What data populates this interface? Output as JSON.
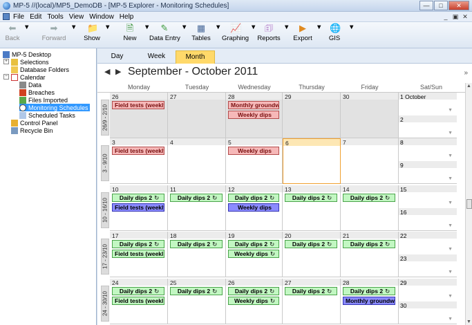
{
  "window": {
    "title": "MP-5 //(local)/MP5_DemoDB - [MP-5 Explorer - Monitoring Schedules]"
  },
  "menu": {
    "items": [
      "File",
      "Edit",
      "Tools",
      "View",
      "Window",
      "Help"
    ]
  },
  "toolbar": {
    "back": "Back",
    "forward": "Forward",
    "show": "Show",
    "new": "New",
    "data_entry": "Data Entry",
    "tables": "Tables",
    "graphing": "Graphing",
    "reports": "Reports",
    "export": "Export",
    "gis": "GIS"
  },
  "tree": {
    "root": "MP-5 Desktop",
    "selections": "Selections",
    "database_folders": "Database Folders",
    "calendar": "Calendar",
    "data": "Data",
    "breaches": "Breaches",
    "files_imported": "Files Imported",
    "monitoring_schedules": "Monitoring Schedules",
    "scheduled_tasks": "Scheduled Tasks",
    "control_panel": "Control Panel",
    "recycle_bin": "Recycle Bin"
  },
  "tabs": {
    "day": "Day",
    "week": "Week",
    "month": "Month"
  },
  "calendar": {
    "title": "September - October 2011",
    "days": [
      "Monday",
      "Tuesday",
      "Wednesday",
      "Thursday",
      "Friday",
      "Sat/Sun"
    ],
    "weeks": [
      {
        "label": "26/9 - 2/10",
        "sat": "1 October",
        "sun": "2",
        "days": [
          {
            "num": "26",
            "grey": true,
            "events": [
              {
                "text": "Field tests (weekly)",
                "color": "pink"
              }
            ]
          },
          {
            "num": "27",
            "grey": true,
            "events": []
          },
          {
            "num": "28",
            "grey": true,
            "events": [
              {
                "text": "Monthly groundwa",
                "color": "pink"
              },
              {
                "text": "Weekly dips",
                "color": "pink",
                "center": true
              }
            ]
          },
          {
            "num": "29",
            "grey": true,
            "events": []
          },
          {
            "num": "30",
            "grey": true,
            "events": []
          }
        ]
      },
      {
        "label": "3 - 9/10",
        "sat": "8",
        "sun": "9",
        "days": [
          {
            "num": "3",
            "events": [
              {
                "text": "Field tests (weekly)",
                "color": "pink"
              }
            ]
          },
          {
            "num": "4",
            "events": []
          },
          {
            "num": "5",
            "events": [
              {
                "text": "Weekly dips",
                "color": "pink",
                "center": true
              }
            ]
          },
          {
            "num": "6",
            "today": true,
            "events": []
          },
          {
            "num": "7",
            "events": []
          }
        ]
      },
      {
        "label": "10 - 16/10",
        "sat": "15",
        "sun": "16",
        "days": [
          {
            "num": "10",
            "events": [
              {
                "text": "Daily dips 2",
                "color": "green",
                "rec": true
              },
              {
                "text": "Field tests (weekly)",
                "color": "blue"
              }
            ]
          },
          {
            "num": "11",
            "events": [
              {
                "text": "Daily dips 2",
                "color": "green",
                "rec": true
              }
            ]
          },
          {
            "num": "12",
            "events": [
              {
                "text": "Daily dips 2",
                "color": "green",
                "rec": true
              },
              {
                "text": "Weekly dips",
                "color": "blue",
                "center": true
              }
            ]
          },
          {
            "num": "13",
            "events": [
              {
                "text": "Daily dips 2",
                "color": "green",
                "rec": true
              }
            ]
          },
          {
            "num": "14",
            "events": [
              {
                "text": "Daily dips 2",
                "color": "green",
                "rec": true
              }
            ]
          }
        ]
      },
      {
        "label": "17 - 23/10",
        "sat": "22",
        "sun": "23",
        "days": [
          {
            "num": "17",
            "events": [
              {
                "text": "Daily dips 2",
                "color": "green",
                "rec": true
              },
              {
                "text": "Field tests (weekl",
                "color": "green",
                "rec": true,
                "left": true
              }
            ]
          },
          {
            "num": "18",
            "events": [
              {
                "text": "Daily dips 2",
                "color": "green",
                "rec": true
              }
            ]
          },
          {
            "num": "19",
            "events": [
              {
                "text": "Daily dips 2",
                "color": "green",
                "rec": true
              },
              {
                "text": "Weekly dips",
                "color": "green",
                "rec": true
              }
            ]
          },
          {
            "num": "20",
            "events": [
              {
                "text": "Daily dips 2",
                "color": "green",
                "rec": true
              }
            ]
          },
          {
            "num": "21",
            "events": [
              {
                "text": "Daily dips 2",
                "color": "green",
                "rec": true
              }
            ]
          }
        ]
      },
      {
        "label": "24 - 30/10",
        "sat": "29",
        "sun": "30",
        "days": [
          {
            "num": "24",
            "events": [
              {
                "text": "Daily dips 2",
                "color": "green",
                "rec": true
              },
              {
                "text": "Field tests (weekl",
                "color": "green",
                "rec": true,
                "left": true
              }
            ]
          },
          {
            "num": "25",
            "events": [
              {
                "text": "Daily dips 2",
                "color": "green",
                "rec": true
              }
            ]
          },
          {
            "num": "26",
            "events": [
              {
                "text": "Daily dips 2",
                "color": "green",
                "rec": true
              },
              {
                "text": "Weekly dips",
                "color": "green",
                "rec": true
              }
            ]
          },
          {
            "num": "27",
            "events": [
              {
                "text": "Daily dips 2",
                "color": "green",
                "rec": true
              }
            ]
          },
          {
            "num": "28",
            "events": [
              {
                "text": "Daily dips 2",
                "color": "green",
                "rec": true
              },
              {
                "text": "Monthly groundwa",
                "color": "blue"
              }
            ]
          }
        ]
      }
    ]
  },
  "glyphs": {
    "rec": "↻",
    "dropdown": "▼",
    "prev": "◀",
    "next": "▶",
    "collapse": "»",
    "up": "▲",
    "down": "▼"
  },
  "colors": {
    "accent": "#ffd96a",
    "selected": "#3399ff",
    "pink": "#f6b8b8",
    "green": "#c2f7c2",
    "blue": "#8b8bff"
  }
}
